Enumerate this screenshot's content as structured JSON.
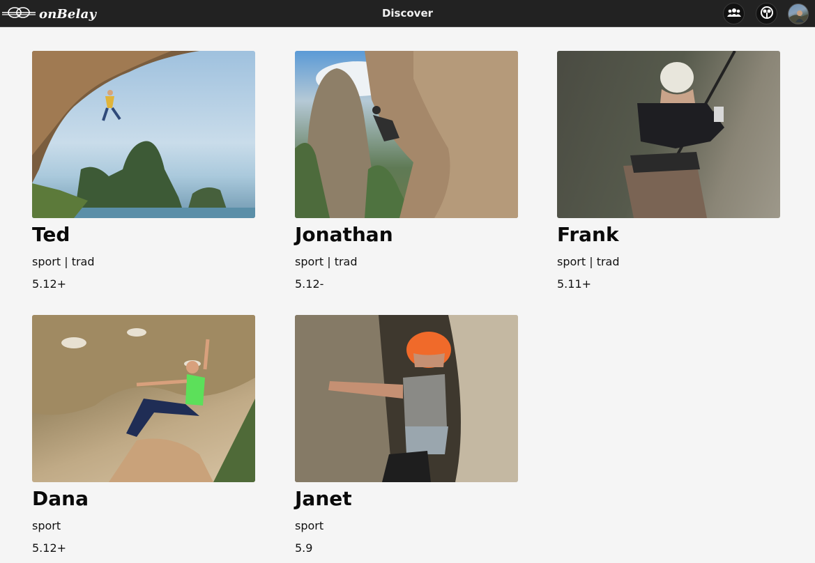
{
  "header": {
    "logo_text": "onBelay",
    "title": "Discover",
    "icons": [
      "group-icon",
      "network-icon"
    ]
  },
  "climbers": [
    {
      "name": "Ted",
      "styles": "sport | trad",
      "grade": "5.12+"
    },
    {
      "name": "Jonathan",
      "styles": "sport | trad",
      "grade": "5.12-"
    },
    {
      "name": "Frank",
      "styles": "sport | trad",
      "grade": "5.11+"
    },
    {
      "name": "Dana",
      "styles": "sport",
      "grade": "5.12+"
    },
    {
      "name": "Janet",
      "styles": "sport",
      "grade": "5.9"
    }
  ]
}
